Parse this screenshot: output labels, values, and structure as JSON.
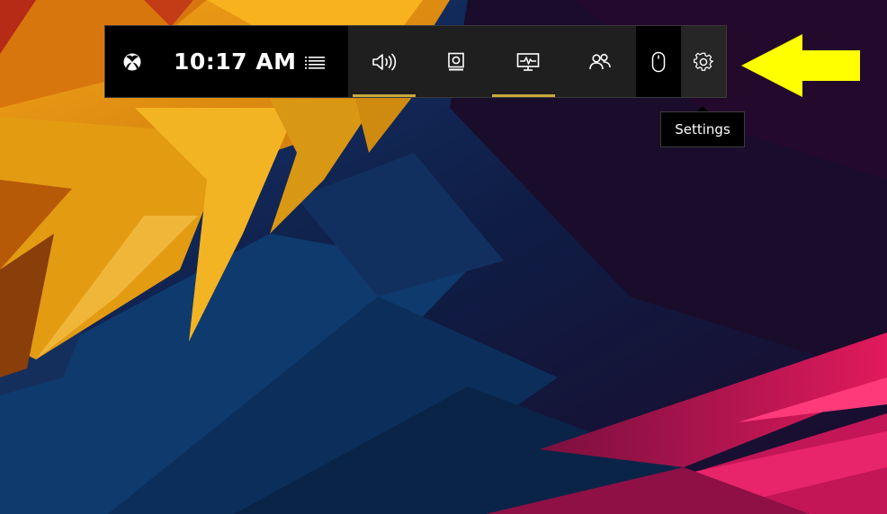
{
  "gamebar": {
    "time": "10:17 AM",
    "icons": {
      "logo": "xbox-logo-icon",
      "menu": "list-menu-icon",
      "audio": "speaker-icon",
      "capture": "capture-icon",
      "performance": "performance-monitor-icon",
      "social": "people-icon",
      "mouse": "mouse-icon",
      "settings": "gear-icon"
    },
    "accent_color": "#c9a93b"
  },
  "tooltip": {
    "label": "Settings"
  },
  "annotation": {
    "arrow_color": "#ffff00"
  }
}
